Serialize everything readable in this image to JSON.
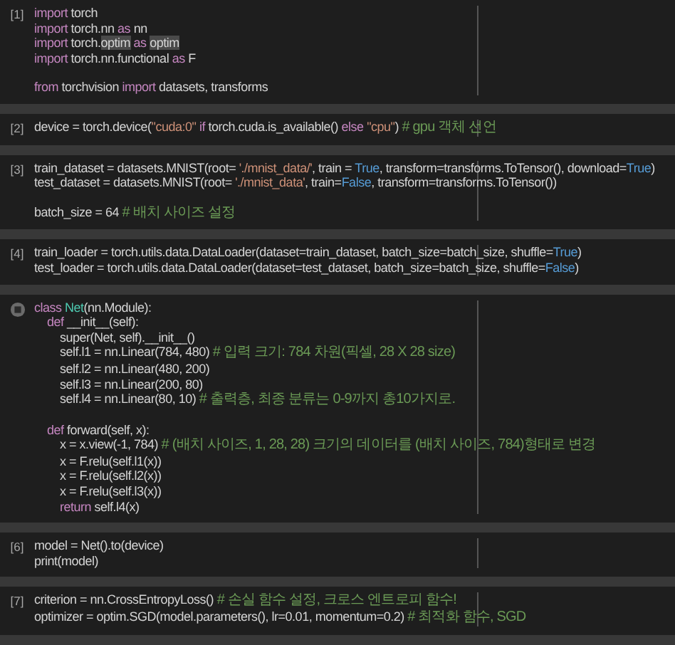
{
  "cells": [
    {
      "kind": "executed",
      "count": "[1]",
      "blocks": [
        {
          "lines": [
            {
              "segments": [
                {
                  "kind": "keyword",
                  "text": "import"
                },
                {
                  "kind": "plain",
                  "text": " torch"
                }
              ]
            },
            {
              "segments": [
                {
                  "kind": "keyword",
                  "text": "import"
                },
                {
                  "kind": "plain",
                  "text": " torch.nn "
                },
                {
                  "kind": "keyword",
                  "text": "as"
                },
                {
                  "kind": "plain",
                  "text": " nn"
                }
              ]
            },
            {
              "segments": [
                {
                  "kind": "keyword",
                  "text": "import"
                },
                {
                  "kind": "plain",
                  "text": " torch."
                },
                {
                  "kind": "plain",
                  "text": "optim",
                  "highlighted": true
                },
                {
                  "kind": "keyword",
                  "text": " as "
                },
                {
                  "kind": "plain",
                  "text": "optim",
                  "highlighted": true
                }
              ]
            },
            {
              "segments": [
                {
                  "kind": "keyword",
                  "text": "import"
                },
                {
                  "kind": "plain",
                  "text": " torch.nn.functional "
                },
                {
                  "kind": "keyword",
                  "text": "as"
                },
                {
                  "kind": "plain",
                  "text": " F"
                }
              ]
            }
          ]
        },
        {
          "lines": [
            {
              "segments": [
                {
                  "kind": "keyword",
                  "text": "from"
                },
                {
                  "kind": "plain",
                  "text": " torchvision "
                },
                {
                  "kind": "keyword",
                  "text": "import"
                },
                {
                  "kind": "plain",
                  "text": " datasets, transforms"
                }
              ]
            }
          ]
        }
      ]
    },
    {
      "kind": "executed",
      "count": "[2]",
      "blocks": [
        {
          "lines": [
            {
              "segments": [
                {
                  "kind": "plain",
                  "text": "device = torch.device("
                },
                {
                  "kind": "string",
                  "text": "\"cuda:0\""
                },
                {
                  "kind": "keyword",
                  "text": " if"
                },
                {
                  "kind": "plain",
                  "text": " torch.cuda.is_available() "
                },
                {
                  "kind": "keyword",
                  "text": "else "
                },
                {
                  "kind": "string",
                  "text": "\"cpu\""
                },
                {
                  "kind": "plain",
                  "text": ") "
                },
                {
                  "kind": "comment",
                  "text": "# gpu 객체 선언"
                }
              ]
            }
          ]
        }
      ]
    },
    {
      "kind": "executed",
      "count": "[3]",
      "blocks": [
        {
          "lines": [
            {
              "segments": [
                {
                  "kind": "plain",
                  "text": "train_dataset = datasets.MNIST(root= "
                },
                {
                  "kind": "string",
                  "text": "'./mnist_data/'"
                },
                {
                  "kind": "plain",
                  "text": ", train = "
                },
                {
                  "kind": "constant",
                  "text": "True"
                },
                {
                  "kind": "plain",
                  "text": ", transform=transforms.ToTensor(), download="
                },
                {
                  "kind": "constant",
                  "text": "True"
                },
                {
                  "kind": "plain",
                  "text": ")"
                }
              ]
            },
            {
              "segments": [
                {
                  "kind": "plain",
                  "text": "test_dataset = datasets.MNIST(root= "
                },
                {
                  "kind": "string",
                  "text": "'./mnist_data'"
                },
                {
                  "kind": "plain",
                  "text": ", train="
                },
                {
                  "kind": "constant",
                  "text": "False"
                },
                {
                  "kind": "plain",
                  "text": ", transform=transforms.ToTensor())"
                }
              ]
            }
          ]
        },
        {
          "lines": [
            {
              "segments": [
                {
                  "kind": "plain",
                  "text": "batch_size = 64 "
                },
                {
                  "kind": "comment",
                  "text": "# 배치 사이즈 설정"
                }
              ]
            }
          ]
        }
      ]
    },
    {
      "kind": "executed",
      "count": "[4]",
      "blocks": [
        {
          "lines": [
            {
              "segments": [
                {
                  "kind": "plain",
                  "text": "train_loader = torch.utils.data.DataLoader(dataset=train_dataset, batch_size=batch_size, shuffle="
                },
                {
                  "kind": "constant",
                  "text": "True"
                },
                {
                  "kind": "plain",
                  "text": ")"
                }
              ]
            },
            {
              "segments": [
                {
                  "kind": "plain",
                  "text": "test_loader = torch.utils.data.DataLoader(dataset=test_dataset, batch_size=batch_size, shuffle="
                },
                {
                  "kind": "constant",
                  "text": "False"
                },
                {
                  "kind": "plain",
                  "text": ")"
                }
              ]
            }
          ]
        }
      ]
    },
    {
      "kind": "run-button",
      "blocks": [
        {
          "lines": [
            {
              "segments": [
                {
                  "kind": "keyword",
                  "text": "class "
                },
                {
                  "kind": "class",
                  "text": "Net"
                },
                {
                  "kind": "plain",
                  "text": "(nn.Module):"
                }
              ]
            },
            {
              "segments": [
                {
                  "kind": "keyword",
                  "text": "    def"
                },
                {
                  "kind": "plain",
                  "text": " __init__(self):"
                }
              ]
            },
            {
              "segments": [
                {
                  "kind": "plain",
                  "text": "        super(Net, self).__init__()"
                }
              ]
            },
            {
              "segments": [
                {
                  "kind": "plain",
                  "text": "        self.l1 = nn.Linear(784, 480) "
                },
                {
                  "kind": "comment",
                  "text": "# 입력 크기: 784 차원(픽셀, 28 X 28 size)"
                }
              ]
            },
            {
              "segments": [
                {
                  "kind": "plain",
                  "text": "        self.l2 = nn.Linear(480, 200)"
                }
              ]
            },
            {
              "segments": [
                {
                  "kind": "plain",
                  "text": "        self.l3 = nn.Linear(200, 80)"
                }
              ]
            },
            {
              "segments": [
                {
                  "kind": "plain",
                  "text": "        self.l4 = nn.Linear(80, 10) "
                },
                {
                  "kind": "comment",
                  "text": "# 출력층, 최종 분류는 0-9까지 총10가지로."
                }
              ]
            }
          ]
        },
        {
          "lines": [
            {
              "segments": [
                {
                  "kind": "keyword",
                  "text": "    def"
                },
                {
                  "kind": "plain",
                  "text": " forward(self, x):"
                }
              ]
            },
            {
              "segments": [
                {
                  "kind": "plain",
                  "text": "        x = x.view(-1, 784) "
                },
                {
                  "kind": "comment",
                  "text": "# (배치 사이즈, 1, 28, 28) 크기의 데이터를 (배치 사이즈, 784)형태로 변경"
                }
              ]
            },
            {
              "segments": [
                {
                  "kind": "plain",
                  "text": "        x = F.relu(self.l1(x))"
                }
              ]
            },
            {
              "segments": [
                {
                  "kind": "plain",
                  "text": "        x = F.relu(self.l2(x))"
                }
              ]
            },
            {
              "segments": [
                {
                  "kind": "plain",
                  "text": "        x = F.relu(self.l3(x))"
                }
              ]
            },
            {
              "segments": [
                {
                  "kind": "keyword",
                  "text": "        return"
                },
                {
                  "kind": "plain",
                  "text": " self.l4(x)"
                }
              ]
            }
          ]
        }
      ]
    },
    {
      "kind": "executed",
      "count": "[6]",
      "blocks": [
        {
          "lines": [
            {
              "segments": [
                {
                  "kind": "plain",
                  "text": "model = Net().to(device)"
                }
              ]
            },
            {
              "segments": [
                {
                  "kind": "plain",
                  "text": "print(model)"
                }
              ]
            }
          ]
        }
      ]
    },
    {
      "kind": "executed",
      "count": "[7]",
      "blocks": [
        {
          "lines": [
            {
              "segments": [
                {
                  "kind": "plain",
                  "text": "criterion = nn.CrossEntropyLoss() "
                },
                {
                  "kind": "comment",
                  "text": "# 손실 함수 설정, 크로스 엔트로피 함수!"
                }
              ]
            },
            {
              "segments": [
                {
                  "kind": "plain",
                  "text": "optimizer = optim.SGD(model.parameters(), lr=0.01, momentum=0.2) "
                },
                {
                  "kind": "comment",
                  "text": "# 최적화 함수, SGD"
                }
              ]
            }
          ]
        }
      ]
    }
  ]
}
